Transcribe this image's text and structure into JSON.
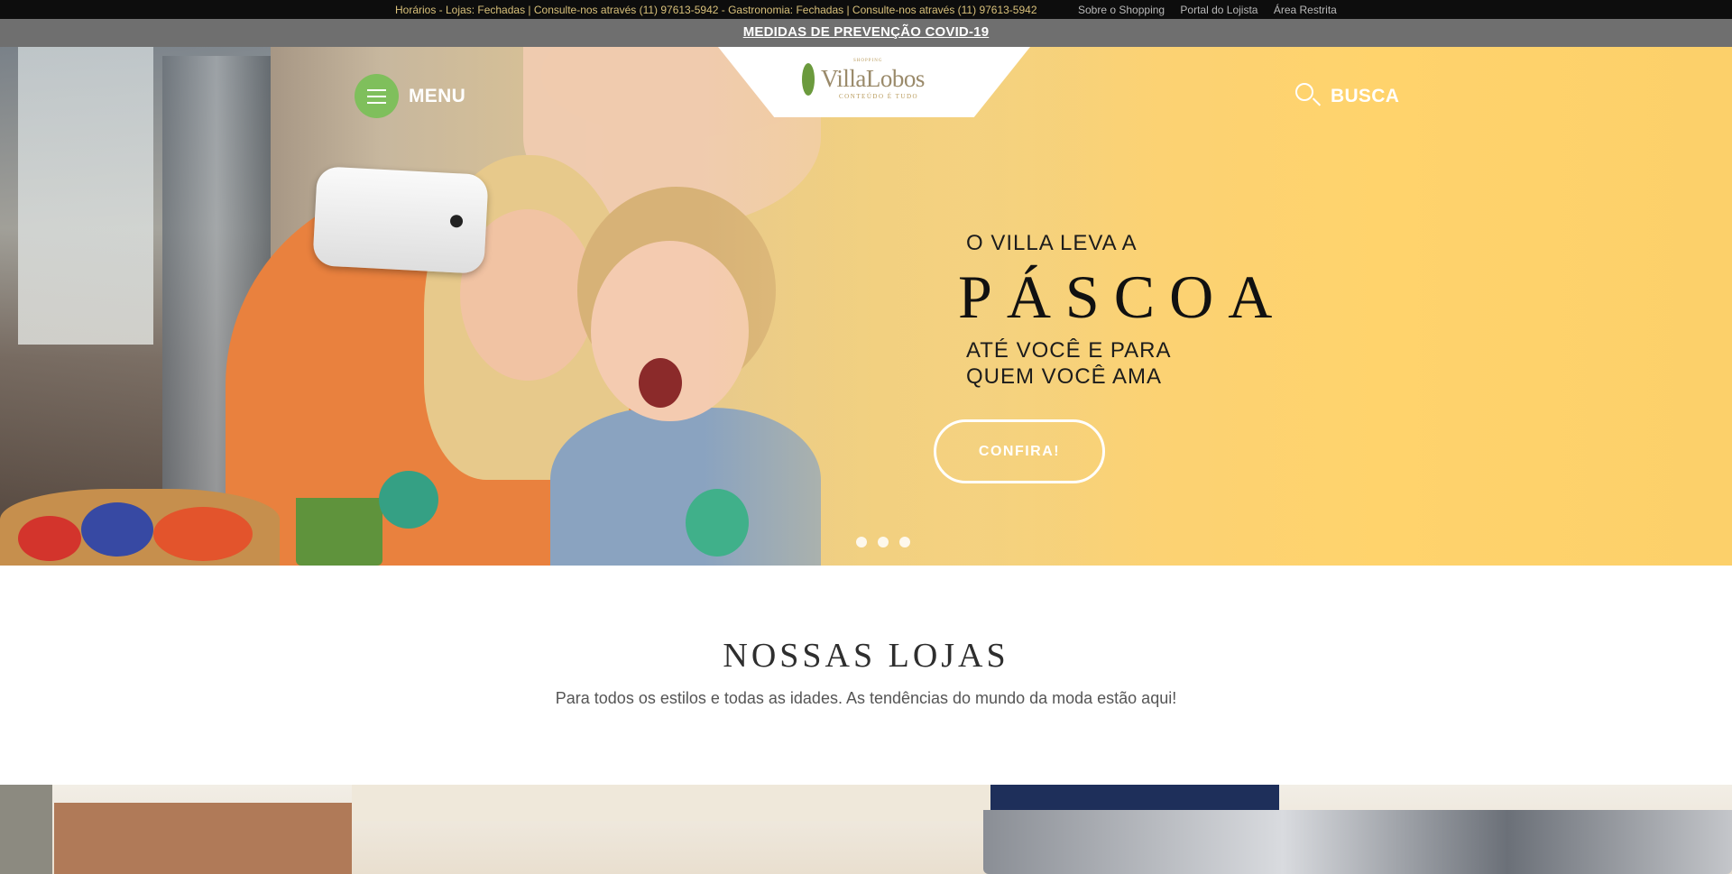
{
  "topbar": {
    "hours": "Horários - Lojas: Fechadas | Consulte-nos através (11) 97613-5942 - Gastronomia: Fechadas | Consulte-nos através (11) 97613-5942",
    "links": [
      "Sobre o Shopping",
      "Portal do Lojista",
      "Área Restrita"
    ]
  },
  "covid": {
    "label": "MEDIDAS DE PREVENÇÃO COVID-19"
  },
  "header": {
    "menu_label": "MENU",
    "search_label": "BUSCA",
    "logo": {
      "small": "SHOPPING",
      "name": "VillaLobos",
      "tagline": "CONTEÚDO É TUDO"
    }
  },
  "hero": {
    "line1": "O VILLA LEVA A",
    "title": "PÁSCOA",
    "line2a": "ATÉ VOCÊ E PARA",
    "line2b": "QUEM VOCÊ AMA",
    "cta": "CONFIRA!",
    "slides": 3,
    "active_slide": 1
  },
  "lojas": {
    "title": "NOSSAS LOJAS",
    "subtitle": "Para todos os estilos e todas as idades. As tendências do mundo da moda estão aqui!"
  },
  "colors": {
    "menu_accent": "#7fbf5c",
    "topbar_bg": "#0d0d0d",
    "topbar_text": "#d8c07a",
    "covid_bg": "#6f6f6f",
    "hero_yellow": "#fcd06a"
  },
  "icons": [
    "menu-icon",
    "search-icon",
    "villalobos-leaf-icon"
  ]
}
